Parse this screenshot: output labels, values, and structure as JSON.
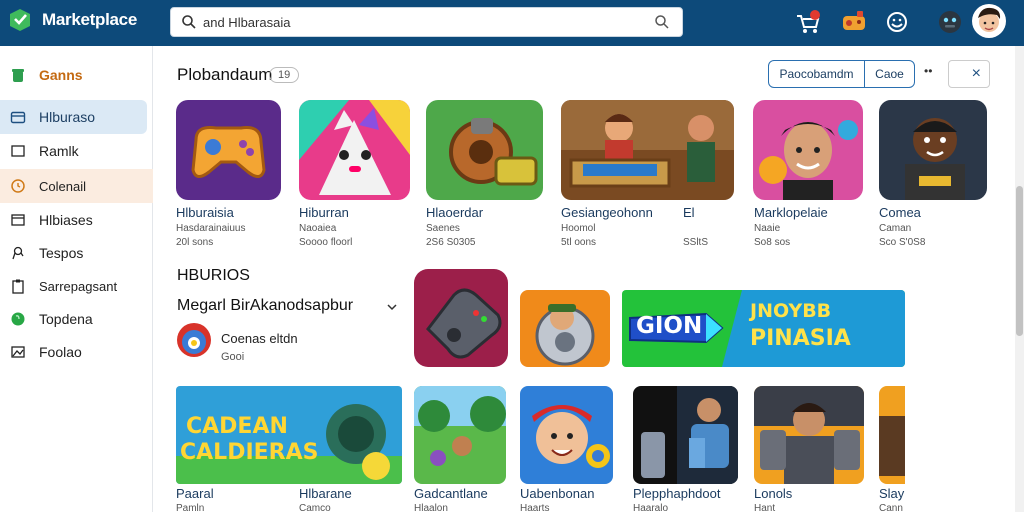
{
  "header": {
    "brand": "Marketplace",
    "search_value": "and Hlbarasaia"
  },
  "sidebar": {
    "items": [
      {
        "label": "Ganns",
        "icon": "trash-icon"
      },
      {
        "label": "Hlburaso",
        "icon": "folder-icon"
      },
      {
        "label": "Ramlk",
        "icon": "square-icon"
      },
      {
        "label": "Colenail",
        "icon": "clock-icon"
      },
      {
        "label": "Hlbiases",
        "icon": "window-icon"
      },
      {
        "label": "Tespos",
        "icon": "pin-icon"
      },
      {
        "label": "Sarrepagsant",
        "icon": "clipboard-icon"
      },
      {
        "label": "Topdena",
        "icon": "circle-icon"
      },
      {
        "label": "Foolao",
        "icon": "image-icon"
      }
    ]
  },
  "section1": {
    "title": "Plobandaum",
    "count": "19",
    "btn_primary": "Paocobamdm",
    "btn_secondary": "Caoe",
    "more": "••",
    "close": "×",
    "games": [
      {
        "name": "Hlburaisia",
        "sub": "Hasdarainaiuus",
        "meta": "20l sons"
      },
      {
        "name": "Hiburran",
        "sub": "Naoaiea",
        "meta": "Soooo floorl"
      },
      {
        "name": "Hlaoerdar",
        "sub": "Saenes",
        "meta": "2S6 S0305"
      },
      {
        "name": "Gesiangeohonn",
        "sub": "Hoomol",
        "meta": "5tl oons"
      },
      {
        "name": "El",
        "sub": "",
        "meta": "SSltS"
      },
      {
        "name": "Marklopelaie",
        "sub": "Naaie",
        "meta": "So8 sos"
      },
      {
        "name": "Comea",
        "sub": "Caman",
        "meta": "Sco S'0S8"
      }
    ]
  },
  "section2": {
    "title": "HBURIOS",
    "dropdown": "Megarl BirAkanodsapbur",
    "item_title": "Coenas eltdn",
    "item_sub": "Gooi",
    "banner_left": "GION",
    "banner_right_1": "JNOYBB",
    "banner_right_2": "PINASIA"
  },
  "section3": {
    "card1_line1": "CADEAN",
    "card1_line2": "CALDIERAS",
    "games": [
      {
        "name": "Paaral",
        "sub": "Pamln"
      },
      {
        "name": "Hlbarane",
        "sub": "Camco"
      },
      {
        "name": "Gadcantlane",
        "sub": "Hlaalon"
      },
      {
        "name": "Uabenbonan",
        "sub": "Haarts"
      },
      {
        "name": "Plepphaphdoot",
        "sub": "Haaralo"
      },
      {
        "name": "Lonols",
        "sub": "Hant"
      },
      {
        "name": "Slay",
        "sub": "Cann"
      }
    ]
  },
  "colors": {
    "topbar": "#0d4a7a",
    "active_item": "#dbe9f5",
    "accent": "#2a6fb0"
  }
}
